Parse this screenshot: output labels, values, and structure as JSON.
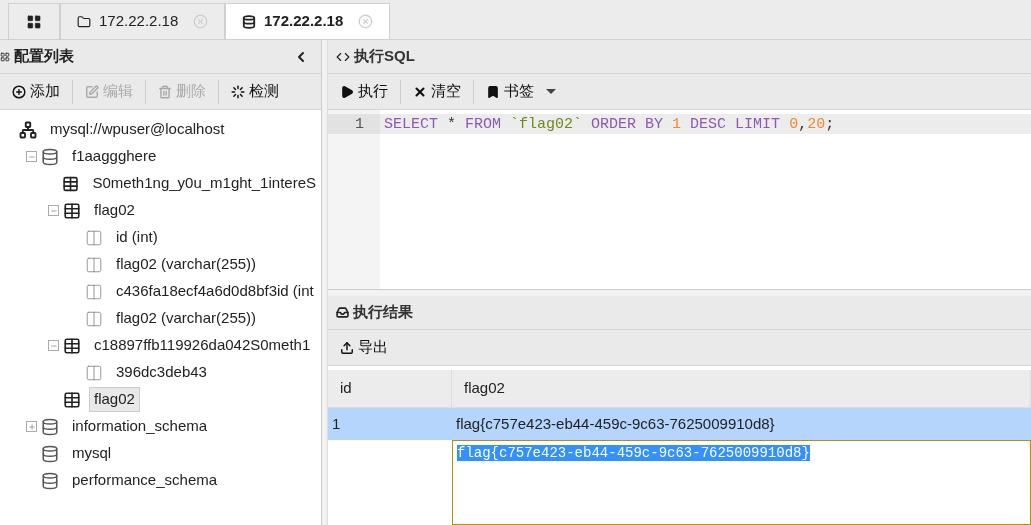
{
  "tabs": [
    {
      "kind": "home",
      "selected": false
    },
    {
      "kind": "folder",
      "label": "172.22.2.18",
      "selected": false
    },
    {
      "kind": "database",
      "label": "172.22.2.18",
      "selected": true
    }
  ],
  "sidebar": {
    "title": "配置列表",
    "toolbar": [
      {
        "kind": "add",
        "label": "添加",
        "disabled": false
      },
      {
        "kind": "edit",
        "label": "编辑",
        "disabled": true
      },
      {
        "kind": "delete",
        "label": "删除",
        "disabled": true
      },
      {
        "kind": "check",
        "label": "检测",
        "disabled": false
      }
    ],
    "tree": [
      {
        "kind": "connection",
        "label": "mysql://wpuser@localhost",
        "selected": false,
        "children": [
          {
            "kind": "database",
            "label": "f1aaggghere",
            "expanded": true,
            "selected": false,
            "children": [
              {
                "kind": "table",
                "label": "S0meth1ng_y0u_m1ght_1intereS",
                "selected": false
              },
              {
                "kind": "table",
                "label": "flag02",
                "expanded": true,
                "selected": false,
                "children": [
                  {
                    "kind": "column",
                    "label": "id (int)",
                    "selected": false
                  },
                  {
                    "kind": "column",
                    "label": "flag02 (varchar(255))",
                    "selected": false
                  },
                  {
                    "kind": "column",
                    "label": "c436fa18ecf4a6d0d8bf3id (int",
                    "selected": false
                  },
                  {
                    "kind": "column",
                    "label": "flag02 (varchar(255))",
                    "selected": false
                  }
                ]
              },
              {
                "kind": "table",
                "label": "c18897ffb119926da042S0meth1",
                "expanded": true,
                "selected": false,
                "children": [
                  {
                    "kind": "column",
                    "label": "396dc3deb43",
                    "selected": false
                  }
                ]
              },
              {
                "kind": "table",
                "label": "flag02",
                "selected": true
              }
            ]
          },
          {
            "kind": "database",
            "label": "information_schema",
            "expanded": false,
            "selected": false
          },
          {
            "kind": "database",
            "label": "mysql",
            "selected": false
          },
          {
            "kind": "database",
            "label": "performance_schema",
            "selected": false
          }
        ]
      }
    ]
  },
  "sql_panel": {
    "title": "执行SQL",
    "toolbar": [
      {
        "kind": "run",
        "label": "执行"
      },
      {
        "kind": "clear",
        "label": "清空"
      },
      {
        "kind": "bookmark",
        "label": "书签"
      }
    ],
    "lines": [
      {
        "number": "1",
        "tokens": [
          {
            "kind": "keyword",
            "text": "SELECT"
          },
          {
            "kind": "plain",
            "text": " * "
          },
          {
            "kind": "keyword",
            "text": "FROM"
          },
          {
            "kind": "string",
            "text": " `flag02`"
          },
          {
            "kind": "keyword",
            "text": " ORDER BY"
          },
          {
            "kind": "number",
            "text": " 1"
          },
          {
            "kind": "keyword",
            "text": " DESC LIMIT"
          },
          {
            "kind": "number",
            "text": " 0"
          },
          {
            "kind": "plain",
            "text": ","
          },
          {
            "kind": "number",
            "text": "20"
          },
          {
            "kind": "plain",
            "text": ";"
          }
        ]
      }
    ]
  },
  "results_panel": {
    "title": "执行结果",
    "toolbar": [
      {
        "kind": "export",
        "label": "导出"
      }
    ],
    "table": {
      "columns": [
        "id",
        "flag02"
      ],
      "rows": [
        {
          "cells": [
            "1",
            "flag{c757e423-eb44-459c-9c63-7625009910d8}"
          ],
          "selected": true
        }
      ]
    },
    "cell_editor": {
      "value": "flag{c757e423-eb44-459c-9c63-7625009910d8}",
      "text_selected": true
    }
  }
}
